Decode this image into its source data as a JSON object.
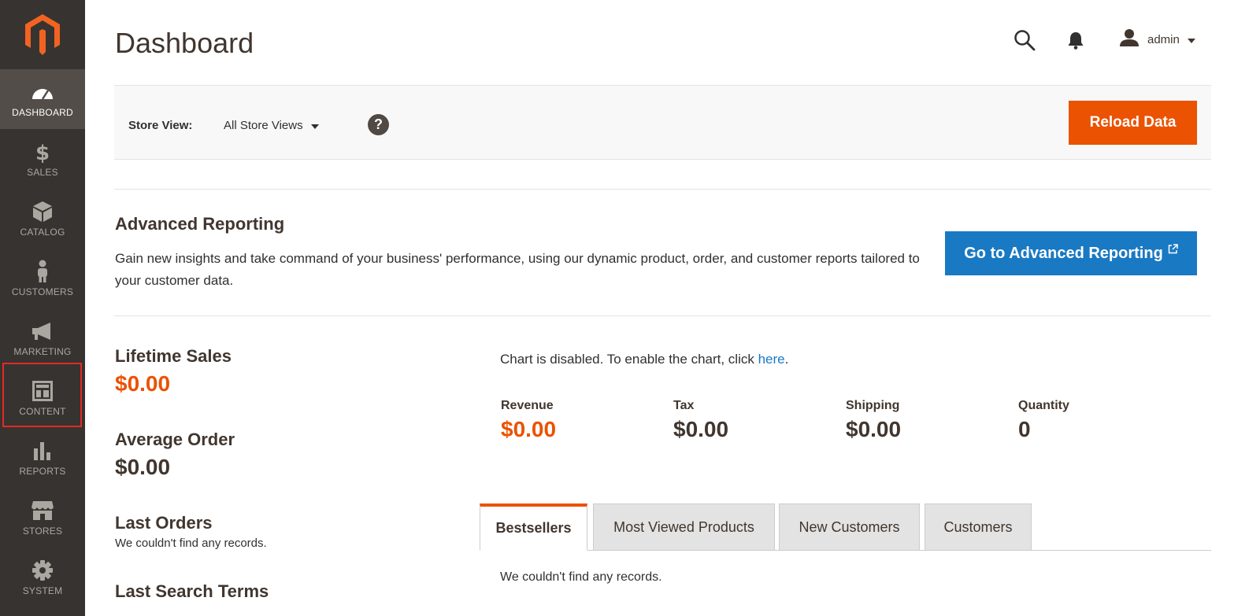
{
  "sidebar": {
    "items": [
      {
        "label": "DASHBOARD",
        "icon": "dashboard-icon"
      },
      {
        "label": "SALES",
        "icon": "dollar-icon"
      },
      {
        "label": "CATALOG",
        "icon": "box-icon"
      },
      {
        "label": "CUSTOMERS",
        "icon": "person-icon"
      },
      {
        "label": "MARKETING",
        "icon": "megaphone-icon"
      },
      {
        "label": "CONTENT",
        "icon": "layout-icon"
      },
      {
        "label": "REPORTS",
        "icon": "bar-chart-icon"
      },
      {
        "label": "STORES",
        "icon": "store-icon"
      },
      {
        "label": "SYSTEM",
        "icon": "gear-icon"
      }
    ]
  },
  "header": {
    "title": "Dashboard",
    "user": "admin"
  },
  "store_view": {
    "label": "Store View:",
    "selected": "All Store Views",
    "help": "?",
    "reload_button": "Reload Data"
  },
  "advanced_reporting": {
    "title": "Advanced Reporting",
    "text": "Gain new insights and take command of your business' performance, using our dynamic product, order, and customer reports tailored to your customer data.",
    "button": "Go to Advanced Reporting"
  },
  "stats": {
    "lifetime_sales_label": "Lifetime Sales",
    "lifetime_sales_value": "$0.00",
    "average_order_label": "Average Order",
    "average_order_value": "$0.00",
    "last_orders_label": "Last Orders",
    "last_orders_note": "We couldn't find any records.",
    "last_search_label": "Last Search Terms"
  },
  "chart": {
    "message_prefix": "Chart is disabled. To enable the chart, click ",
    "link": "here",
    "message_suffix": "."
  },
  "totals": {
    "revenue_label": "Revenue",
    "revenue_value": "$0.00",
    "tax_label": "Tax",
    "tax_value": "$0.00",
    "shipping_label": "Shipping",
    "shipping_value": "$0.00",
    "quantity_label": "Quantity",
    "quantity_value": "0"
  },
  "tabs": {
    "items": [
      "Bestsellers",
      "Most Viewed Products",
      "New Customers",
      "Customers"
    ],
    "content": "We couldn't find any records."
  },
  "colors": {
    "accent_orange": "#eb5202",
    "link_blue": "#1979c3",
    "sidebar_bg": "#373330",
    "highlight_red": "#e02b27"
  }
}
